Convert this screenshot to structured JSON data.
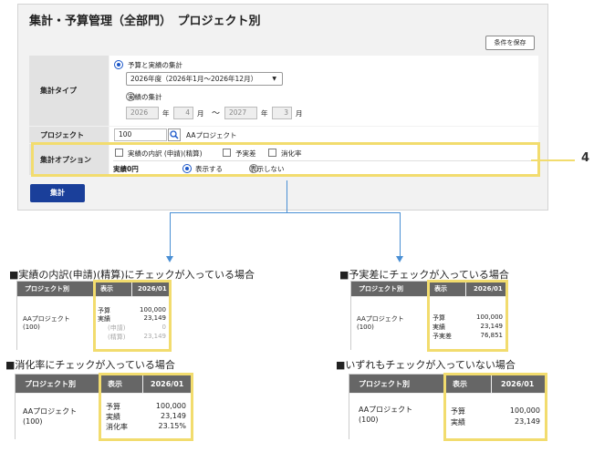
{
  "panel": {
    "title": "集計・予算管理（全部門）　プロジェクト別",
    "save_label": "条件を保存"
  },
  "aggregation_type": {
    "label": "集計タイプ",
    "option1": "予算と実績の集計",
    "fiscal_select": "2026年度（2026年1月〜2026年12月）",
    "option2": "実績の集計",
    "from_year": "2026",
    "from_year_unit": "年",
    "from_month": "4",
    "from_month_unit": "月",
    "range_sep": "〜",
    "to_year": "2027",
    "to_year_unit": "年",
    "to_month": "3",
    "to_month_unit": "月"
  },
  "project": {
    "label": "プロジェクト",
    "code": "100",
    "name": "AAプロジェクト"
  },
  "options": {
    "label": "集計オプション",
    "check1": "実績の内訳 (申請)(精算)",
    "check2": "予実差",
    "check3": "消化率",
    "zero_label": "実績0円",
    "show": "表示する",
    "hide": "表示しない"
  },
  "exec_label": "集計",
  "callout": "4",
  "examples": [
    {
      "heading": "■実績の内訳(申請)(精算)にチェックが入っている場合",
      "col_project": "プロジェクト別",
      "col_display": "表示",
      "col_period": "2026/01",
      "project_name": "AAプロジェクト",
      "project_code": "(100)",
      "rows": [
        {
          "label": "予算",
          "value": "100,000"
        },
        {
          "label": "実績",
          "value": "23,149"
        },
        {
          "label": "(申請)",
          "value": "0"
        },
        {
          "label": "(精算)",
          "value": "23,149"
        }
      ]
    },
    {
      "heading": "■予実差にチェックが入っている場合",
      "col_project": "プロジェクト別",
      "col_display": "表示",
      "col_period": "2026/01",
      "project_name": "AAプロジェクト",
      "project_code": "(100)",
      "rows": [
        {
          "label": "予算",
          "value": "100,000"
        },
        {
          "label": "実績",
          "value": "23,149"
        },
        {
          "label": "予実差",
          "value": "76,851"
        }
      ]
    },
    {
      "heading": "■消化率にチェックが入っている場合",
      "col_project": "プロジェクト別",
      "col_display": "表示",
      "col_period": "2026/01",
      "project_name": "AAプロジェクト",
      "project_code": "(100)",
      "rows": [
        {
          "label": "予算",
          "value": "100,000"
        },
        {
          "label": "実績",
          "value": "23,149"
        },
        {
          "label": "消化率",
          "value": "23.15%"
        }
      ]
    },
    {
      "heading": "■いずれもチェックが入っていない場合",
      "col_project": "プロジェクト別",
      "col_display": "表示",
      "col_period": "2026/01",
      "project_name": "AAプロジェクト",
      "project_code": "(100)",
      "rows": [
        {
          "label": "予算",
          "value": "100,000"
        },
        {
          "label": "実績",
          "value": "23,149"
        }
      ]
    }
  ],
  "colors": {
    "highlight": "#f2dc6e",
    "accent": "#1a56c8",
    "button": "#1a3f9a",
    "arrow": "#4a8fd4"
  }
}
